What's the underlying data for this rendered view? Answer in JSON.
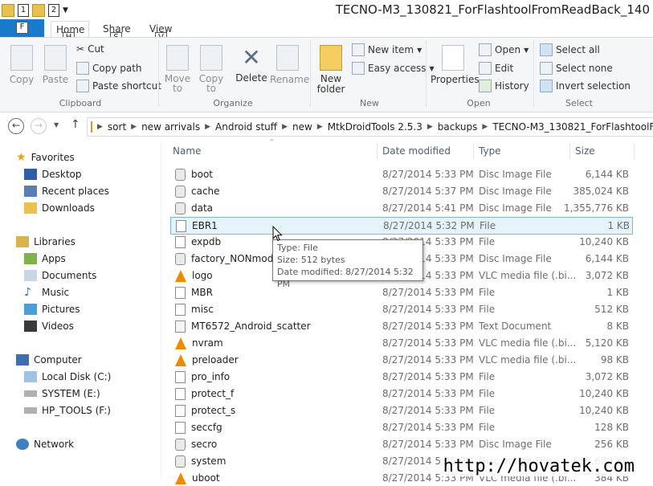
{
  "window": {
    "title": "TECNO-M3_130821_ForFlashtoolFromReadBack_140"
  },
  "quick_access": {
    "keytip_1": "1",
    "keytip_2": "2"
  },
  "tabs": [
    {
      "label": "File",
      "keytip": "F"
    },
    {
      "label": "Home",
      "keytip": "H"
    },
    {
      "label": "Share",
      "keytip": "S"
    },
    {
      "label": "View",
      "keytip": "V"
    }
  ],
  "ribbon": {
    "clipboard": {
      "label": "Clipboard",
      "copy": "Copy",
      "paste": "Paste",
      "cut": "Cut",
      "copy_path": "Copy path",
      "paste_shortcut": "Paste shortcut"
    },
    "organize": {
      "label": "Organize",
      "move_to": "Move",
      "move_to_2": "to",
      "copy_to": "Copy",
      "copy_to_2": "to",
      "delete": "Delete",
      "rename": "Rename"
    },
    "new": {
      "label": "New",
      "new_folder": "New",
      "new_folder_2": "folder",
      "new_item": "New item",
      "easy_access": "Easy access"
    },
    "open": {
      "label": "Open",
      "properties": "Properties",
      "open": "Open",
      "edit": "Edit",
      "history": "History"
    },
    "select": {
      "label": "Select",
      "select_all": "Select all",
      "select_none": "Select none",
      "invert_selection": "Invert selection"
    }
  },
  "breadcrumb": [
    "sort",
    "new arrivals",
    "Android stuff",
    "new",
    "MtkDroidTools 2.5.3",
    "backups",
    "TECNO-M3_130821_ForFlashtoolFromR"
  ],
  "nav": {
    "favorites": "Favorites",
    "desktop": "Desktop",
    "recent_places": "Recent places",
    "downloads": "Downloads",
    "libraries": "Libraries",
    "apps": "Apps",
    "documents": "Documents",
    "music": "Music",
    "pictures": "Pictures",
    "videos": "Videos",
    "computer": "Computer",
    "local_disk": "Local Disk (C:)",
    "system": "SYSTEM (E:)",
    "hp_tools": "HP_TOOLS (F:)",
    "network": "Network"
  },
  "columns": {
    "name": "Name",
    "date": "Date modified",
    "type": "Type",
    "size": "Size"
  },
  "files": [
    {
      "name": "boot",
      "date": "8/27/2014 5:33 PM",
      "type": "Disc Image File",
      "size": "6,144 KB",
      "icon": "disc"
    },
    {
      "name": "cache",
      "date": "8/27/2014 5:37 PM",
      "type": "Disc Image File",
      "size": "385,024 KB",
      "icon": "disc"
    },
    {
      "name": "data",
      "date": "8/27/2014 5:41 PM",
      "type": "Disc Image File",
      "size": "1,355,776 KB",
      "icon": "disc"
    },
    {
      "name": "EBR1",
      "date": "8/27/2014 5:32 PM",
      "type": "File",
      "size": "1 KB",
      "icon": "file"
    },
    {
      "name": "expdb",
      "date": "8/27/2014 5:33 PM",
      "type": "File",
      "size": "10,240 KB",
      "icon": "file"
    },
    {
      "name": "factory_NONmodified",
      "date": "8/27/2014 5:33 PM",
      "type": "Disc Image File",
      "size": "6,144 KB",
      "icon": "disc"
    },
    {
      "name": "logo",
      "date": "8/27/2014 5:33 PM",
      "type": "VLC media file (.bi...",
      "size": "3,072 KB",
      "icon": "vlc"
    },
    {
      "name": "MBR",
      "date": "8/27/2014 5:33 PM",
      "type": "File",
      "size": "1 KB",
      "icon": "file"
    },
    {
      "name": "misc",
      "date": "8/27/2014 5:33 PM",
      "type": "File",
      "size": "512 KB",
      "icon": "file"
    },
    {
      "name": "MT6572_Android_scatter",
      "date": "8/27/2014 5:33 PM",
      "type": "Text Document",
      "size": "8 KB",
      "icon": "txt"
    },
    {
      "name": "nvram",
      "date": "8/27/2014 5:33 PM",
      "type": "VLC media file (.bi...",
      "size": "5,120 KB",
      "icon": "vlc"
    },
    {
      "name": "preloader",
      "date": "8/27/2014 5:33 PM",
      "type": "VLC media file (.bi...",
      "size": "98 KB",
      "icon": "vlc"
    },
    {
      "name": "pro_info",
      "date": "8/27/2014 5:33 PM",
      "type": "File",
      "size": "3,072 KB",
      "icon": "file"
    },
    {
      "name": "protect_f",
      "date": "8/27/2014 5:33 PM",
      "type": "File",
      "size": "10,240 KB",
      "icon": "file"
    },
    {
      "name": "protect_s",
      "date": "8/27/2014 5:33 PM",
      "type": "File",
      "size": "10,240 KB",
      "icon": "file"
    },
    {
      "name": "seccfg",
      "date": "8/27/2014 5:33 PM",
      "type": "File",
      "size": "128 KB",
      "icon": "file"
    },
    {
      "name": "secro",
      "date": "8/27/2014 5:33 PM",
      "type": "Disc Image File",
      "size": "256 KB",
      "icon": "disc"
    },
    {
      "name": "system",
      "date": "8/27/2014 5:35 PM",
      "type": "Disc Image File",
      "size": "655,600 KB",
      "icon": "disc"
    },
    {
      "name": "uboot",
      "date": "8/27/2014 5:33 PM",
      "type": "VLC media file (.bi...",
      "size": "384 KB",
      "icon": "vlc"
    }
  ],
  "tooltip": {
    "type": "Type: File",
    "size": "Size: 512 bytes",
    "date": "Date modified: 8/27/2014 5:32 PM"
  },
  "watermark": "http://hovatek.com"
}
